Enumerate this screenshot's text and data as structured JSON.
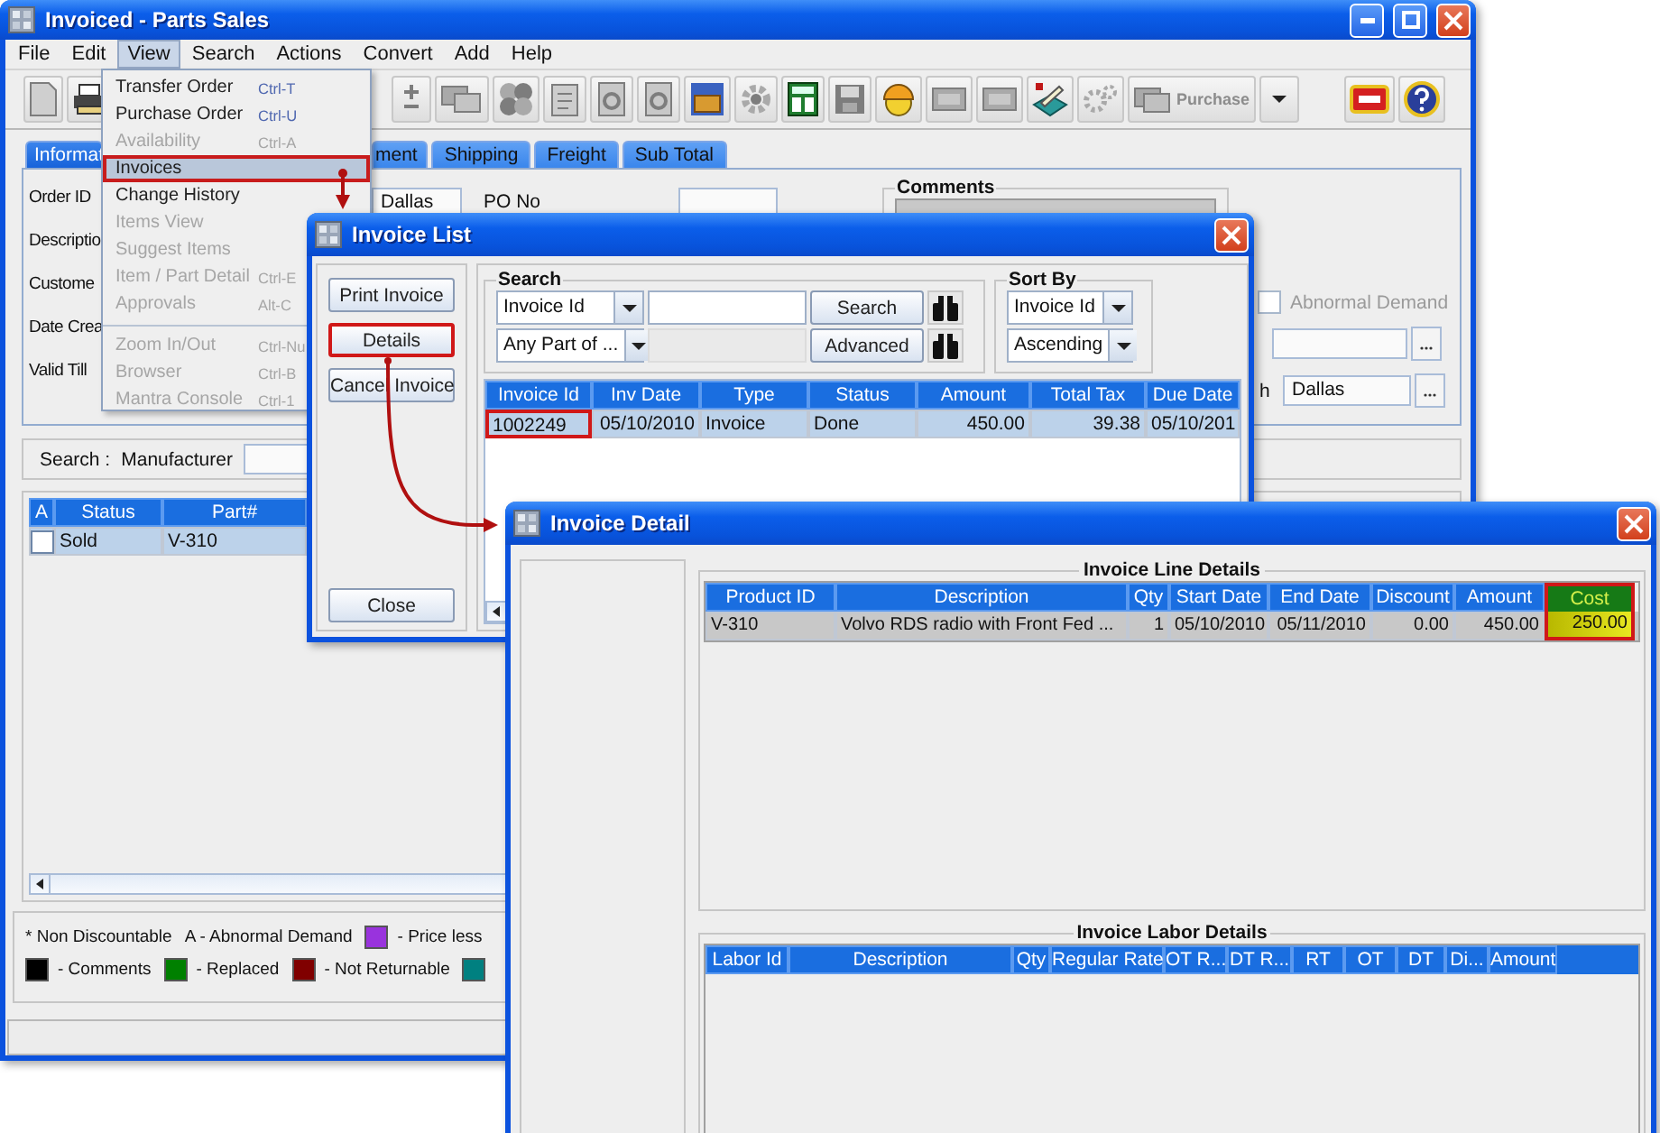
{
  "main_window": {
    "title": "Invoiced - Parts Sales",
    "menu": [
      {
        "label": "File",
        "selected": false
      },
      {
        "label": "Edit",
        "selected": false
      },
      {
        "label": "View",
        "selected": true
      },
      {
        "label": "Search",
        "selected": false
      },
      {
        "label": "Actions",
        "selected": false
      },
      {
        "label": "Convert",
        "selected": false
      },
      {
        "label": "Add",
        "selected": false
      },
      {
        "label": "Help",
        "selected": false
      }
    ],
    "purchase_button": "Purchase",
    "tabs": [
      {
        "label": "Informat",
        "selected": true
      },
      {
        "label": "ment",
        "selected": false
      },
      {
        "label": "Shipping",
        "selected": false
      },
      {
        "label": "Freight",
        "selected": false
      },
      {
        "label": "Sub Total",
        "selected": false
      }
    ],
    "form": {
      "labels": [
        "Order ID",
        "Descriptio",
        "Custome",
        "Date Crea",
        "Valid Till"
      ],
      "branch_value": "Dallas",
      "po_label": "PO No",
      "comments_title": "Comments",
      "abnormal_demand": {
        "label": "Abnormal Demand",
        "checked": false,
        "disabled": true
      },
      "location_label": "h",
      "location_value": "Dallas"
    },
    "search": {
      "label": "Search :",
      "field_label": "Manufacturer"
    },
    "parts_table": {
      "columns": [
        "A",
        "Status",
        "Part#"
      ],
      "rows": [
        {
          "checked": false,
          "status": "Sold",
          "part": "V-310",
          "selected": true
        }
      ]
    },
    "legend": [
      [
        {
          "kind": "note",
          "label": "* Non Discountable"
        },
        {
          "kind": "note",
          "label": "A - Abnormal Demand"
        },
        {
          "kind": "swatch",
          "color": "#9933dd",
          "label": "- Price less"
        }
      ],
      [
        {
          "kind": "swatch",
          "color": "#000000",
          "label": "- Comments"
        },
        {
          "kind": "swatch",
          "color": "#008000",
          "label": "- Replaced"
        },
        {
          "kind": "swatch",
          "color": "#800000",
          "label": "- Not Returnable"
        },
        {
          "kind": "swatch",
          "color": "#008080"
        }
      ]
    ]
  },
  "view_menu": [
    [
      {
        "label": "Transfer Order",
        "shortcut": "Ctrl-T",
        "disabled": false,
        "selected": false
      },
      {
        "label": "Purchase Order",
        "shortcut": "Ctrl-U",
        "disabled": false,
        "selected": false
      },
      {
        "label": "Availability",
        "shortcut": "Ctrl-A",
        "disabled": true,
        "selected": false
      },
      {
        "label": "Invoices",
        "disabled": false,
        "selected": true
      },
      {
        "label": "Change History",
        "disabled": false,
        "selected": false
      },
      {
        "label": "Items View",
        "disabled": true,
        "selected": false
      },
      {
        "label": "Suggest Items",
        "disabled": true,
        "selected": false
      },
      {
        "label": "Item / Part Detail",
        "shortcut": "Ctrl-E",
        "disabled": true,
        "selected": false
      },
      {
        "label": "Approvals",
        "shortcut": "Alt-C",
        "disabled": true,
        "selected": false
      }
    ],
    [
      {
        "label": "Zoom In/Out",
        "shortcut": "Ctrl-Nu",
        "disabled": true,
        "selected": false
      },
      {
        "label": "Browser",
        "shortcut": "Ctrl-B",
        "disabled": true,
        "selected": false
      },
      {
        "label": "Mantra Console",
        "shortcut": "Ctrl-1",
        "disabled": true,
        "selected": false
      }
    ]
  ],
  "invoice_list": {
    "title": "Invoice List",
    "buttons": [
      {
        "label": "Print Invoice",
        "highlighted": false
      },
      {
        "label": "Details",
        "highlighted": true
      },
      {
        "label": "Cancel Invoice",
        "highlighted": false
      }
    ],
    "close_button": "Close",
    "search": {
      "title": "Search",
      "field": "Invoice Id",
      "match": "Any Part of ...",
      "search_button": "Search",
      "advanced_button": "Advanced"
    },
    "sort": {
      "title": "Sort By",
      "field": "Invoice Id",
      "order": "Ascending"
    },
    "columns": [
      {
        "label": "Invoice Id",
        "kind": "text"
      },
      {
        "label": "Inv Date",
        "kind": "number"
      },
      {
        "label": "Type",
        "kind": "text"
      },
      {
        "label": "Status",
        "kind": "text"
      },
      {
        "label": "Amount",
        "kind": "number"
      },
      {
        "label": "Total Tax",
        "kind": "number"
      },
      {
        "label": "Due Date",
        "kind": "number"
      }
    ],
    "rows": [
      {
        "selected": true,
        "cells": [
          {
            "text": "1002249",
            "highlighted": true
          },
          {
            "text": "05/10/2010",
            "highlighted": false
          },
          {
            "text": "Invoice",
            "highlighted": false
          },
          {
            "text": "Done",
            "highlighted": false
          },
          {
            "text": "450.00",
            "highlighted": false
          },
          {
            "text": "39.38",
            "highlighted": false
          },
          {
            "text": "05/10/201",
            "highlighted": false
          }
        ]
      }
    ]
  },
  "invoice_detail": {
    "title": "Invoice Detail",
    "line_title": "Invoice Line Details",
    "line_columns": [
      {
        "label": "Product ID",
        "kind": "text",
        "highlighted": false
      },
      {
        "label": "Description",
        "kind": "text",
        "highlighted": false
      },
      {
        "label": "Qty",
        "kind": "number",
        "highlighted": false
      },
      {
        "label": "Start Date",
        "kind": "number",
        "highlighted": false
      },
      {
        "label": "End Date",
        "kind": "number",
        "highlighted": false
      },
      {
        "label": "Discount",
        "kind": "number",
        "highlighted": false
      },
      {
        "label": "Amount",
        "kind": "number",
        "highlighted": false
      },
      {
        "label": "Cost",
        "kind": "number",
        "highlighted": true
      }
    ],
    "line_rows": [
      {
        "selected": true,
        "cells": [
          "V-310",
          "Volvo RDS radio with Front Fed ...",
          "1",
          "05/10/2010",
          "05/11/2010",
          "0.00",
          "450.00",
          "250.00"
        ]
      }
    ],
    "labor_title": "Invoice Labor Details",
    "labor_columns": [
      "Labor Id",
      "Description",
      "Qty",
      "Regular Rate",
      "OT R...",
      "DT R...",
      "RT",
      "OT",
      "DT",
      "Di...",
      "Amount"
    ]
  }
}
